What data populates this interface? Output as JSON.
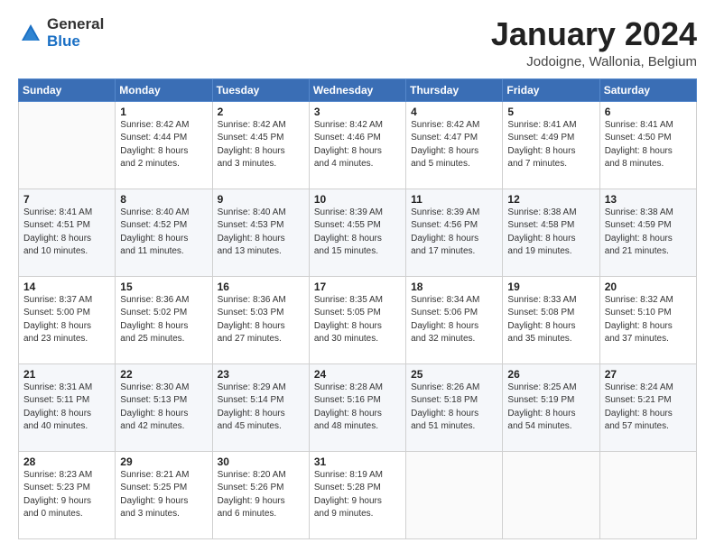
{
  "logo": {
    "general": "General",
    "blue": "Blue"
  },
  "title": "January 2024",
  "location": "Jodoigne, Wallonia, Belgium",
  "days_of_week": [
    "Sunday",
    "Monday",
    "Tuesday",
    "Wednesday",
    "Thursday",
    "Friday",
    "Saturday"
  ],
  "weeks": [
    [
      {
        "day": "",
        "info": ""
      },
      {
        "day": "1",
        "info": "Sunrise: 8:42 AM\nSunset: 4:44 PM\nDaylight: 8 hours\nand 2 minutes."
      },
      {
        "day": "2",
        "info": "Sunrise: 8:42 AM\nSunset: 4:45 PM\nDaylight: 8 hours\nand 3 minutes."
      },
      {
        "day": "3",
        "info": "Sunrise: 8:42 AM\nSunset: 4:46 PM\nDaylight: 8 hours\nand 4 minutes."
      },
      {
        "day": "4",
        "info": "Sunrise: 8:42 AM\nSunset: 4:47 PM\nDaylight: 8 hours\nand 5 minutes."
      },
      {
        "day": "5",
        "info": "Sunrise: 8:41 AM\nSunset: 4:49 PM\nDaylight: 8 hours\nand 7 minutes."
      },
      {
        "day": "6",
        "info": "Sunrise: 8:41 AM\nSunset: 4:50 PM\nDaylight: 8 hours\nand 8 minutes."
      }
    ],
    [
      {
        "day": "7",
        "info": "Sunrise: 8:41 AM\nSunset: 4:51 PM\nDaylight: 8 hours\nand 10 minutes."
      },
      {
        "day": "8",
        "info": "Sunrise: 8:40 AM\nSunset: 4:52 PM\nDaylight: 8 hours\nand 11 minutes."
      },
      {
        "day": "9",
        "info": "Sunrise: 8:40 AM\nSunset: 4:53 PM\nDaylight: 8 hours\nand 13 minutes."
      },
      {
        "day": "10",
        "info": "Sunrise: 8:39 AM\nSunset: 4:55 PM\nDaylight: 8 hours\nand 15 minutes."
      },
      {
        "day": "11",
        "info": "Sunrise: 8:39 AM\nSunset: 4:56 PM\nDaylight: 8 hours\nand 17 minutes."
      },
      {
        "day": "12",
        "info": "Sunrise: 8:38 AM\nSunset: 4:58 PM\nDaylight: 8 hours\nand 19 minutes."
      },
      {
        "day": "13",
        "info": "Sunrise: 8:38 AM\nSunset: 4:59 PM\nDaylight: 8 hours\nand 21 minutes."
      }
    ],
    [
      {
        "day": "14",
        "info": "Sunrise: 8:37 AM\nSunset: 5:00 PM\nDaylight: 8 hours\nand 23 minutes."
      },
      {
        "day": "15",
        "info": "Sunrise: 8:36 AM\nSunset: 5:02 PM\nDaylight: 8 hours\nand 25 minutes."
      },
      {
        "day": "16",
        "info": "Sunrise: 8:36 AM\nSunset: 5:03 PM\nDaylight: 8 hours\nand 27 minutes."
      },
      {
        "day": "17",
        "info": "Sunrise: 8:35 AM\nSunset: 5:05 PM\nDaylight: 8 hours\nand 30 minutes."
      },
      {
        "day": "18",
        "info": "Sunrise: 8:34 AM\nSunset: 5:06 PM\nDaylight: 8 hours\nand 32 minutes."
      },
      {
        "day": "19",
        "info": "Sunrise: 8:33 AM\nSunset: 5:08 PM\nDaylight: 8 hours\nand 35 minutes."
      },
      {
        "day": "20",
        "info": "Sunrise: 8:32 AM\nSunset: 5:10 PM\nDaylight: 8 hours\nand 37 minutes."
      }
    ],
    [
      {
        "day": "21",
        "info": "Sunrise: 8:31 AM\nSunset: 5:11 PM\nDaylight: 8 hours\nand 40 minutes."
      },
      {
        "day": "22",
        "info": "Sunrise: 8:30 AM\nSunset: 5:13 PM\nDaylight: 8 hours\nand 42 minutes."
      },
      {
        "day": "23",
        "info": "Sunrise: 8:29 AM\nSunset: 5:14 PM\nDaylight: 8 hours\nand 45 minutes."
      },
      {
        "day": "24",
        "info": "Sunrise: 8:28 AM\nSunset: 5:16 PM\nDaylight: 8 hours\nand 48 minutes."
      },
      {
        "day": "25",
        "info": "Sunrise: 8:26 AM\nSunset: 5:18 PM\nDaylight: 8 hours\nand 51 minutes."
      },
      {
        "day": "26",
        "info": "Sunrise: 8:25 AM\nSunset: 5:19 PM\nDaylight: 8 hours\nand 54 minutes."
      },
      {
        "day": "27",
        "info": "Sunrise: 8:24 AM\nSunset: 5:21 PM\nDaylight: 8 hours\nand 57 minutes."
      }
    ],
    [
      {
        "day": "28",
        "info": "Sunrise: 8:23 AM\nSunset: 5:23 PM\nDaylight: 9 hours\nand 0 minutes."
      },
      {
        "day": "29",
        "info": "Sunrise: 8:21 AM\nSunset: 5:25 PM\nDaylight: 9 hours\nand 3 minutes."
      },
      {
        "day": "30",
        "info": "Sunrise: 8:20 AM\nSunset: 5:26 PM\nDaylight: 9 hours\nand 6 minutes."
      },
      {
        "day": "31",
        "info": "Sunrise: 8:19 AM\nSunset: 5:28 PM\nDaylight: 9 hours\nand 9 minutes."
      },
      {
        "day": "",
        "info": ""
      },
      {
        "day": "",
        "info": ""
      },
      {
        "day": "",
        "info": ""
      }
    ]
  ]
}
